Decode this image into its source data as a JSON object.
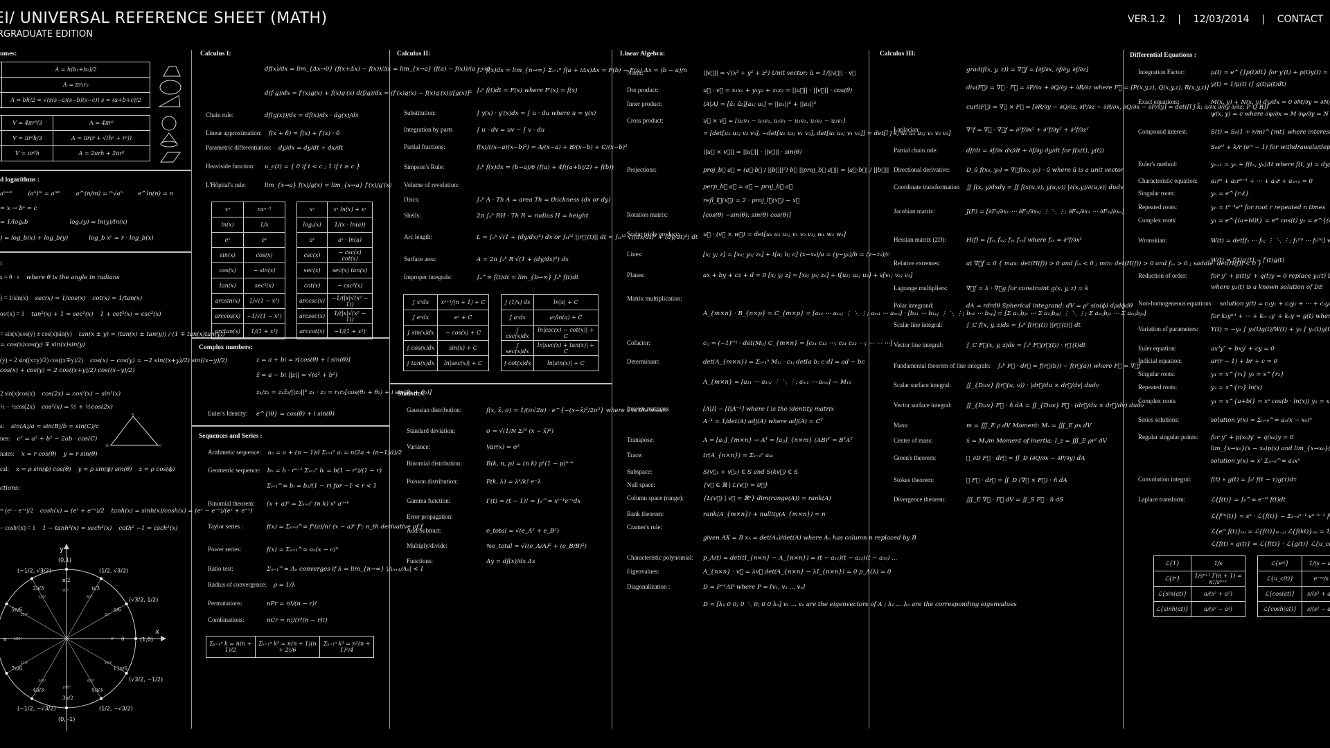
{
  "header": {
    "title": "EI/ UNIVERSAL REFERENCE SHEET (MATH)",
    "subtitle": "RGRADUATE EDITION",
    "version": "VER.1.2",
    "separator": "|",
    "date": "12/03/2014",
    "contact": "CONTACT"
  },
  "geometry": {
    "title": "umes:",
    "area_table": [
      "A = h(b₁+b₂)/2",
      "A = πr₁r₂",
      "A = bh/2 = √(s(s−a)(s−b)(s−c))   s = (a+b+c)/2"
    ],
    "volume_table": [
      [
        "V = 4πr³/3",
        "A = 4πr²"
      ],
      [
        "V = πr²h/3",
        "A = πr(r + √(h² + r²))"
      ],
      [
        "V = πr²h",
        "A = 2πrh + 2πr²"
      ]
    ]
  },
  "logs": {
    "title": "d logarithms :",
    "rows": [
      [
        "aⁿ⁺ᵐ",
        "(aⁿ)ᵐ = aⁿᵐ",
        "a^(n/m) = ᵐ√aⁿ",
        "e^ln(n) = n"
      ],
      [
        "= x  →  bˣ = c"
      ],
      [
        "= 1/logₐb",
        "logₓ(y) = ln(y)/ln(x)"
      ],
      [
        ") = log_b(x) + log_b(y)",
        "log_b xʳ = r · log_b(x)"
      ]
    ]
  },
  "trig": {
    "title": ":",
    "rows": [
      [
        "s = θ · r",
        "where θ is the angle in radians"
      ],
      [
        ") = 1/sin(x)",
        "sec(x) = 1/cos(x)",
        "cot(x) = 1/tan(x)"
      ],
      [
        "os²(x) = 1",
        "tan²(x) + 1 = sec²(x)",
        "1 + cot²(x) = csc²(x)"
      ],
      [
        "= sin(x)cos(y) ± cos(x)sin(y)",
        "tan(x ± y) = (tan(x) ± tan(y)) / (1 ∓ tan(x)tan(y))"
      ],
      [
        "= cos(x)cos(y) ∓ sin(x)sin(y)"
      ],
      [
        "(y) = 2 sin((x±y)/2) cos((x∓y)/2)",
        "cos(x) − cos(y) = −2 sin((x+y)/2) sin((x−y)/2)"
      ],
      [
        "cos(x) + cos(y) = 2 cos((x+y)/2) cos((x−y)/2)"
      ],
      [
        "2 sin(x)cos(x)",
        "cos(2x) = cos²(x) − sin²(x)"
      ],
      [
        "½ − ½cos(2x)",
        "cos²(x) = ½ + ½cos(2x)"
      ],
      [
        "s:",
        "sin(A)/a = sin(B)/b = sin(C)/c"
      ],
      [
        "nes:",
        "c² = a² + b² − 2ab · cos(C)"
      ],
      [
        "nates:",
        "x = r cos(θ)",
        "y = r sin(θ)"
      ],
      [
        "cal:",
        "x = ρ sin(ϕ) cos(θ)",
        "y = ρ sin(ϕ) sin(θ)",
        "z = ρ cos(ϕ)"
      ],
      [
        "ctions:"
      ],
      [
        "= (eˣ − e⁻ˣ)/2",
        "cosh(x) = (eˣ + e⁻ˣ)/2",
        "tanh(x) = sinh(x)/cosh(x) = (eˣ − e⁻ˣ)/(eˣ + e⁻ˣ)"
      ],
      [
        "− cosh²(x) = 1",
        "1 − tanh²(x) = sech²(x)",
        "coth² −1 = csch²(x)"
      ]
    ],
    "triangle_labels": {
      "A": "A",
      "B": "B",
      "C": "C",
      "a": "a",
      "b": "b",
      "c": "c"
    }
  },
  "unit_circle": {
    "axis_x": "x",
    "axis_y": "y",
    "points": [
      {
        "deg": "0°",
        "rad": "0",
        "coord": "(1,0)"
      },
      {
        "deg": "30°",
        "rad": "π/6",
        "coord": "(√3/2, 1/2)"
      },
      {
        "deg": "60°",
        "rad": "π/3",
        "coord": "(1/2, √3/2)"
      },
      {
        "deg": "90°",
        "rad": "π/2",
        "coord": "(0,1)"
      },
      {
        "deg": "120°",
        "rad": "2π/3",
        "coord": "(−1/2, √3/2)"
      },
      {
        "deg": "150°",
        "rad": "5π/6",
        "coord": ""
      },
      {
        "deg": "180°",
        "rad": "π",
        "coord": ""
      },
      {
        "deg": "210°",
        "rad": "7π/6",
        "coord": ""
      },
      {
        "deg": "240°",
        "rad": "4π/3",
        "coord": "(−1/2, −√3/2)"
      },
      {
        "deg": "270°",
        "rad": "3π/2",
        "coord": "(0, -1)"
      },
      {
        "deg": "300°",
        "rad": "5π/3",
        "coord": "(1/2, −√3/2)"
      },
      {
        "deg": "330°",
        "rad": "11π/6",
        "coord": "(√3/2, −1/2)"
      }
    ]
  },
  "calc1": {
    "title": "Calculus I:",
    "rows": [
      [
        "",
        "df(x)/dx = lim_{Δx→0} (f(x+Δx) − f(x))/Δx = lim_{x→a} (f(a) − f(x))/(a − x)"
      ],
      [
        "",
        "d(f·g)/dx = f′(x)g(x) + f(x)g′(x)        d(f/g)/dx = (f′(x)g(x) − f(x)g′(x))/[g(x)]²"
      ],
      [
        "Chain rule:",
        "df(g(x))/dx = df(x)/dx · dg(x)/dx"
      ],
      [
        "Linear approximation:",
        "f(x + δ) ≈ f(x) + f′(x) · δ"
      ],
      [
        "Parametric differentiation:",
        "dy/dx = dy/dt ÷ dx/dt"
      ],
      [
        "Heaviside function:",
        "u_c(t) = { 0 if t < c ; 1 if t ≥ c }"
      ],
      [
        "L'Hôpital's rule:",
        "lim_{x→a} f(x)/g(x) = lim_{x→a} f′(x)/g′(x)"
      ]
    ],
    "deriv_table_1": [
      [
        "xⁿ",
        "nxⁿ⁻¹"
      ],
      [
        "ln(x)",
        "1/x"
      ],
      [
        "eˣ",
        "eˣ"
      ],
      [
        "sin(x)",
        "cos(x)"
      ],
      [
        "cos(x)",
        "− sin(x)"
      ],
      [
        "tan(x)",
        "sec²(x)"
      ],
      [
        "arcsin(x)",
        "1/√(1 − x²)"
      ],
      [
        "arccos(x)",
        "−1/√(1 − x²)"
      ],
      [
        "arctan(x)",
        "1/(1 + x²)"
      ]
    ],
    "deriv_table_2": [
      [
        "xˣ",
        "xˣ ln(x) + xˣ"
      ],
      [
        "logₐ(x)",
        "1/(x · ln(a))"
      ],
      [
        "aˣ",
        "aˣ · ln(a)"
      ],
      [
        "csc(x)",
        "− csc(x) cot(x)"
      ],
      [
        "sec(x)",
        "sec(x) tan(x)"
      ],
      [
        "cot(x)",
        "− csc²(x)"
      ],
      [
        "arccsc(x)",
        "−1/(|x|√(x² − 1))"
      ],
      [
        "arcsec(x)",
        "1/(|x|√(x² − 1))"
      ],
      [
        "arccot(x)",
        "−1/(1 + x²)"
      ]
    ]
  },
  "complex": {
    "title": "Complex numbers:",
    "rows": [
      [
        "",
        "z = a + bi = r[cos(θ) + i sin(θ)]"
      ],
      [
        "",
        "z̄ = a − bi        ||z|| = √(a² + b²)"
      ],
      [
        "",
        "z₁/z₂ = z₁z̄₂/||z₂||²        z₁ · z₂ = r₁r₂[cos(θ₁ + θ₂) + i sin(θ₁ + θ₂)]"
      ],
      [
        "Euler's Identity:",
        "e^{iθ} = cos(θ) + i sin(θ)"
      ]
    ]
  },
  "series": {
    "title": "Sequences and Series :",
    "rows": [
      [
        "Arithmetic sequence:",
        "aₙ = a + (n − 1)d     Σᵢ₌₁ⁿ aᵢ = n(2a + (n−1)d)/2"
      ],
      [
        "Geometric sequence:",
        "bₙ = b · rⁿ⁻¹         Σᵢ₌₁ⁿ bᵢ = b(1 − rⁿ)/(1 − r)"
      ],
      [
        "",
        "Σᵢ₌₁^∞ bᵢ = b₁/(1 − r)   for −1 < r < 1"
      ],
      [
        "Binomial theorem:",
        "(x + a)ⁿ = Σₖ₌₀ⁿ (n k) xᵏ aⁿ⁻ᵏ"
      ],
      [
        "Taylor series :",
        "f(x) = Σₙ₌₀^∞ fⁿ(a)/n! (x − a)ⁿ     fⁿ: n_th derivative of f"
      ],
      [
        "Power series:",
        "f(x) = Σₙ₌₁^∞ aₙ(x − c)ⁿ"
      ],
      [
        "Ratio test:",
        "Σₙ₌₁^∞ Aₙ  converges if λ = lim_{n→∞} |Aₙ₊₁/Aₙ| < 1"
      ],
      [
        "    Radius of convergence:",
        "ρ = 1/λ"
      ],
      [
        "Permutations:",
        "nPr = n!/(n − r)!"
      ],
      [
        "Combinations:",
        "nCr = n!/(r!(n − r)!)"
      ]
    ],
    "sums": [
      "Σₖ₌₁ⁿ k = n(n + 1)/2",
      "Σₖ₌₁ⁿ k² = n(n + 1)(n + 2)/6",
      "Σₖ₌₁ⁿ k³ = n²(n + 1)²/4"
    ]
  },
  "calc2": {
    "title": "Calculus II:",
    "rows": [
      [
        "",
        "∫ₐᵇ f(x)dx = lim_{n→∞} Σᵢ₌₁ⁿ f(a + iΔx)Δx = F(b) − F(a)        Δx = (b − a)/n"
      ],
      [
        "",
        "∫ₐˣ f(t)dt = F(x)        where F′(x) = f(x)"
      ],
      [
        "Substitution:",
        "∫ y(x) · y′(x)dx = ∫ u · du       where u = y(x)"
      ],
      [
        "Integration by parts",
        "∫ u · dv = uv − ∫ v · du"
      ],
      [
        "Partial fractions:",
        "f(x)/((x−a)(x−b)²) = A/(x−a) + B/(x−b) + C/(x−b)²"
      ],
      [
        "Simpson's Rule:",
        "∫ₐᵇ f(x)dx ≈ (b−a)/6 (f(a) + 4f((a+b)/2) + f(b))"
      ],
      [
        "Volume of revolution:",
        ""
      ],
      [
        "      Discs:",
        "∫ₐᵇ A · Th      A = area      Th = thickness (dx or dy)"
      ],
      [
        "      Shells:",
        "2π ∫ₐᵇ RH · Th      R = radius      H = height"
      ],
      [
        "Arc length:",
        "L = ∫ₐᵇ √(1 + (dy/dx)²) dx   or   ∫ₜ₁ᵗ² ||r⃗′(t)|| dt = ∫ₜ₁ᵗ² √((dx/dt)² + (dy/dt)²) dt"
      ],
      [
        "Surface area:",
        "A = 2π ∫ₐᵇ R √(1 + (dy/dx)²) dx"
      ],
      [
        "Improper integrals:",
        "∫ₐ^∞ f(t)dt = lim_{b→∞} ∫ₐᵇ f(t)dt"
      ]
    ],
    "int_table_1": [
      [
        "∫ xⁿdx",
        "xⁿ⁺¹/(n + 1) + C"
      ],
      [
        "∫ eˣdx",
        "eˣ + C"
      ],
      [
        "∫ sin(x)dx",
        "− cos(x) + C"
      ],
      [
        "∫ cos(x)dx",
        "sin(x) + C"
      ],
      [
        "∫ tan(x)dx",
        "ln|sec(x)| + C"
      ]
    ],
    "int_table_2": [
      [
        "∫ (1/x) dx",
        "ln|x| + C"
      ],
      [
        "∫ aˣdx",
        "aˣ/ln(a) + C"
      ],
      [
        "∫ csc(x)dx",
        "ln|csc(x) − cot(x)| + C"
      ],
      [
        "∫ sec(x)dx",
        "ln|sec(x) + tan(x)| + C"
      ],
      [
        "∫ cot(x)dx",
        "ln|sin(x)| + C"
      ]
    ]
  },
  "stats": {
    "title": "Statistics:",
    "rows": [
      [
        "Gaussian distribution:",
        "f(x, x̄, σ) = 1/(σ√2π) · e^{−(x−x̄)²/2σ²}   where x̄ is the mean"
      ],
      [
        "Standard deviation:",
        "σ = √(1/N Σᵢᴺ (x − x̄)²)"
      ],
      [
        "Variance:",
        "Var(x) = σ²"
      ],
      [
        "Binomial distribution:",
        "B(k, n, p) = (n k) pᵏ(1 − p)ⁿ⁻ᵏ"
      ],
      [
        "Poisson distribution:",
        "P(k, λ) = λᵏ/k! e⁻λ"
      ],
      [
        "Gamma function:",
        "Γ(t) = (t − 1)! = ∫₀^∞ xᵗ⁻¹e⁻ˣdx"
      ],
      [
        "Error propagation:",
        ""
      ],
      [
        "      Add/Subtract:",
        "e_total = √(e_A² + e_B²)"
      ],
      [
        "      Multiply/divide:",
        "%e_total = √((e_A/A)² + (e_B/B)²)"
      ],
      [
        "      Functions:",
        "Δy = df(x)/dx Δx"
      ]
    ]
  },
  "linalg": {
    "title": "Linear Algebra:",
    "rows": [
      [
        "Norm:",
        "||v⃗|| = √(x² + y² + z²)              Unit vector:    û = 1/||v⃗|| · v⃗"
      ],
      [
        "Dot product:",
        "u⃗ · v⃗ = x₁x₂ + y₁y₂ + z₁z₂ = ||u⃗|| · ||v⃗|| · cos(θ)"
      ],
      [
        "        Inner product:",
        "⟨A|A⟩ = [ā₁ ā₂][a₁; a₂] = ||a₁||² + ||a₂||²"
      ],
      [
        "Cross product:",
        "u⃗ × v⃗ = [u₂v₃ − u₃v₂, u₃v₁ − u₁v₃, u₁v₂ − u₂v₁]"
      ],
      [
        "",
        "= [det[u₂ u₃; v₂ v₃], −det[u₁ u₃; v₁ v₃], det[u₁ u₂; v₁ v₂]] = det[î ĵ k̂; u₁ u₂ u₃; v₁ v₂ v₃]"
      ],
      [
        "",
        "||u⃗ × v⃗|| = ||u⃗|| · ||v⃗|| · sin(θ)"
      ],
      [
        "Projections:",
        "proj_b⃗ a⃗ = (a⃗·b⃗ / ||b⃗||²) b⃗          ||proj_b⃗ a⃗|| = |a⃗·b⃗| / ||b⃗||"
      ],
      [
        "",
        "perp_b⃗ a⃗ = a⃗ − proj_b⃗ a⃗"
      ],
      [
        "",
        "refl_l⃗(x⃗) = 2 · proj_l⃗(x⃗) − x⃗"
      ],
      [
        "Rotation matrix:",
        "[cos(θ) −sin(θ); sin(θ) cos(θ)]"
      ],
      [
        "Scalar triple product:",
        "u⃗ · (v⃗ × w⃗) = det[u₁ u₂ u₃; v₁ v₂ v₃; w₁ w₂ w₃]"
      ],
      [
        "Lines:",
        "[x; y; z] = [x₀; y₀; z₀] + t[a; b; c]      (x−x₀)/a = (y−y₀)/b = (z−z₀)/c"
      ],
      [
        "Planes:",
        "ax + by + cz + d = 0      [x; y; z] = [x₀; y₀; z₀] + t[u₁; u₂; u₃] + s[v₁; v₂; v₃]"
      ],
      [
        "Matrix multiplication:",
        ""
      ],
      [
        "",
        "A_{m×n} · B_{n×p} = C_{m×p} = [a₁₁ ⋯ a₁ₙ; ⋮ ⋱ ⋮; aₘ₁ ⋯ aₘₙ] · [b₁₁ ⋯ b₁ₚ; ⋮ ⋱ ⋮; bₙ₁ ⋯ bₙₚ] = [Σ a₁ⱼbⱼ₁ ⋯ Σ a₁ⱼbⱼₚ; ⋮ ⋱ ⋮; Σ aₘⱼbⱼ₁ ⋯ Σ aₘⱼbⱼₚ]"
      ],
      [
        "Cofactor:",
        "cᵢⱼ = (−1)ⁱ⁺ʲ · det(Mᵢⱼ)      C_{m×n} = [c₁₁ c₁₂ ⋯; c₂₁ c₂₂ ⋯; ⋯ ⋯ ⋯]"
      ],
      [
        "Determinant:",
        "det(A_{m×n}) = Σⱼ₌₁ⁿ M₁ⱼ · c₁ⱼ        det[a b; c d] = ad − bc"
      ],
      [
        "",
        "A_{m×n} = [a₁₁ ⋯ a₁ₙ; ⋮ ⋱ ⋮; aₘ₁ ⋯ aₘₙ]   — M₁₁"
      ],
      [
        "Inverse matrices:",
        "[A|I] ~ [I|A⁻¹]    where I is the identity matrix"
      ],
      [
        "",
        "A⁻¹ = 1/det(A) adj(A)       where adj(A) = Cᵀ"
      ],
      [
        "Transpose:",
        "A = [aᵢⱼ]_{m×n} → Aᵀ = [aⱼᵢ]_{n×m}           (AB)ᵀ = BᵀAᵀ"
      ],
      [
        "Trace:",
        "tr(A_{n×n}) = Σₖ₌₁ⁿ aₖₖ"
      ],
      [
        "Subspace:",
        "S(v⃗₁ + v⃗₂) ∈ S    and    S(kv⃗) ∈ S"
      ],
      [
        "        Null space:",
        "{v⃗ ∈ ℝ | L(v⃗) = 0⃗}"
      ],
      [
        "        Column space (range):",
        "{L(v⃗) | v⃗ = ℝⁿ}           dim(range(A)) = rank(A)"
      ],
      [
        "Rank theorem:",
        "rank(A_{m×n}) + nullity(A_{m×n}) = n"
      ],
      [
        "Cramer's rule:",
        ""
      ],
      [
        "",
        "given AX = B        xₙ = det(Aₙ)/det(A)       where Aₙ has column n replaced by B"
      ],
      [
        "Characteristic polynomial:",
        "p_A(t) = det(tI_{n×n} − A_{n×n}) = (t − a₁₁)(t − a₂₂)(t − a₃₃) ..."
      ],
      [
        "Eigenvalues:",
        "A_{n×n} · v⃗ = λv⃗        det(A_{n×n} − λI_{n×n}) = 0         p_A(λ) = 0"
      ],
      [
        "Diagonalization :",
        "D = P⁻¹AP     where P = [v₁, v₂ ... vₙ]"
      ],
      [
        "",
        "D = [λ₁ 0 0; 0 ⋱ 0; 0 0 λₙ]     v₁ ... vₙ are the eigenvectors of A ; λ₁ ... λₙ are the corresponding eigenvalues"
      ]
    ]
  },
  "calc3": {
    "title": "Calculus III:",
    "rows": [
      [
        "",
        "grad(f(x, y, z)) = ∇⃗f = [∂f/∂x, ∂f/∂y, ∂f/∂z]"
      ],
      [
        "",
        "div(F⃗) = ∇⃗ · F⃗ = ∂P/∂x + ∂Q/∂y + ∂R/∂z        where F⃗ = [P(x,y,z), Q(x,y,z), R(x,y,z)]"
      ],
      [
        "",
        "curl(F⃗) = ∇⃗ × F⃗ = [∂R/∂y − ∂Q/∂z, ∂P/∂z − ∂R/∂x, ∂Q/∂x − ∂P/∂y] = det([î ĵ k̂; ∂/∂x ∂/∂y ∂/∂z; P Q R])"
      ],
      [
        "Laplacian:",
        "∇²f = ∇⃗ · ∇⃗f = ∂²f/∂x² + ∂²f/∂y² + ∂²f/∂z²"
      ],
      [
        "Partial chain rule:",
        "df/dt = ∂f/∂x dx/dt + ∂f/∂y dy/dt        for f(x(t), y(t))"
      ],
      [
        "Directional derivative:",
        "D_û f(x₀, y₀) = ∇⃗f(x₀, y₀) · û     where û is a unit vector"
      ],
      [
        "Coordinate transformation",
        "∬ f(x, y)dxdy = ∬ f(x(u,v), y(u,v)) |∂(x,y)/∂(u,v)| dudv"
      ],
      [
        "Jacobian matrix:",
        "J(F) = [∂F₁/∂x₁ ⋯ ∂F₁/∂xₙ; ⋮ ⋱ ⋮; ∂Fₘ/∂x₁ ⋯ ∂Fₘ/∂xₙ]"
      ],
      [
        "Hessian matrix (2D):",
        "H(f) = [fₓₓ fₓᵧ; fᵧₓ fᵧᵧ]   where fₓₓ = ∂²f/∂x²"
      ],
      [
        "Relative extremes:",
        "at ∇⃗f = 0   { max: det(H(f)) > 0 and fₓₓ < 0 ; min: det(H(f)) > 0 and fₓₓ > 0 ; saddle: det(H(f)) < 0 }"
      ],
      [
        "Lagrange multipliers:",
        "∇⃗f = λ · ∇⃗g     for constraint g(x, y, z) = k"
      ],
      [
        "Polar integrand:",
        "dA = rdrdθ              Spherical integrand:   dV = ρ² sin(ϕ) dρdϕdθ"
      ],
      [
        "Scalar line integral:",
        "∫_C f(x, y, z)ds = ∫ₐᵇ f(r⃗(t)) ||r⃗′(t)|| dt"
      ],
      [
        "Vector line integral:",
        "∫_C F⃗(x, y, z)ds = ∫ₐᵇ F⃗(r⃗(t)) · r⃗′(t)dt"
      ],
      [
        "Fundamental theorem of line integrals:",
        "∫ₐᵇ F⃗ · dr⃗ = f(r⃗(b)) − f(r⃗(a))    where F⃗ = ∇⃗f"
      ],
      [
        "Scalar surface integral:",
        "∬_{Duv} f(r⃗(u, v)) · |dr⃗/du × dr⃗/dv| dudv"
      ],
      [
        "Vector surface integral:",
        "∬_{Duv} F⃗ · n̂ dA = ∬_{Duv} F⃗ · (dr⃗/du × dr⃗/dv) dudv"
      ],
      [
        "Mass:",
        "m = ∭_E ρ dV                 Moment:      Mₓ = ∭_E ρx dV"
      ],
      [
        "Center of mass:",
        "x̄ = Mₓ/m                   Moment of inertia:     I_z = ∭_E ρr² dV"
      ],
      [
        "Green's theorem:",
        "∮_∂D F⃗ · dr⃗ = ∬_D (∂Q/∂x − ∂P/∂y) dA"
      ],
      [
        "Stokes theorem:",
        "∮ F⃗ · dr⃗ = ∬_D (∇⃗ × F⃗) · n̂ dA"
      ],
      [
        "Divergence theorem:",
        "∭_E ∇⃗ · F⃗ dV = ∬_S F⃗ · n̂ dS"
      ]
    ]
  },
  "diffeq": {
    "title": "Differential Equations :",
    "rows": [
      [
        "Integration Factor:",
        "μ(t) = e^{∫p(t)dt}     for  y′(t) + p(t)y(t) = g(t)"
      ],
      [
        "",
        "y(t) = 1/μ(t) (∫ g(t)μ(t)dt)"
      ],
      [
        "Exact equations:",
        "M(x, y) + N(x, y) dy/dx = 0       ∂M/∂y = ∂N/∂x"
      ],
      [
        "",
        "ψ(x, y) = c     where  ∂ψ/∂x = M   ∂ψ/∂y = N"
      ],
      [
        "Compound interest:",
        "S(t) = S₀(1 + r/m)^{mt}   where interest is compounded"
      ],
      [
        "",
        "S₀eʳᵗ + k/r (eʳᵗ − 1)    for withdrawals/deposits at"
      ],
      [
        "Euler's method:",
        "yₙ₊₁ = yₙ + f(tₙ, yₙ)Δt    where  f(t, y) = dy/dt"
      ],
      [
        "Characteristic equation:",
        "a₁rⁿ + a₂rⁿ⁻¹ + ⋯ + aₙr + aₙ₊₁ = 0"
      ],
      [
        "      Singular roots:",
        "yₙ = e^{rₙt}"
      ],
      [
        "      Repeated roots:",
        "yₙ = tⁿ⁻¹eʳᵗ      for root r repeated n times"
      ],
      [
        "      Complex roots:",
        "y₁ = e^{(a+bi)t} = eᵃᵗ cos(t)       y₂ = e^{(a−bi)t} ="
      ],
      [
        "Wronskian:",
        "W(t) = det[f₁ ⋯ fₙ; ⋮ ⋱ ⋮; f₁⁽ⁿ⁾ ⋯ fₙ⁽ⁿ⁾]     where f⁽ⁿ⁾ is the nth deriv"
      ],
      [
        "",
        "W(t) = f(t)g′(t) − f′(t)g(t)"
      ],
      [
        "Reduction of order:",
        "for y″ + p(t)y′ + q(t)y = 0      replace y₂(t) by v(t"
      ],
      [
        "",
        "where y₂(t) is a known solution of DE"
      ],
      [
        "Non-homogeneous equations:",
        "solution  y(t) = c₁y₁ + c₂y₂ + ⋯ + cₙyₙ"
      ],
      [
        "",
        "for k₁y⁽ⁿ⁾ + ⋯ + kₙ₋₁y′ + kₙy = g(t)  where Y(t) is related"
      ],
      [
        "      Variation of parameters:",
        "Y(t) = −y₁ ∫ y₂(t)g(t)/W(t) + y₂ ∫ y₁(t)g(t)/W(t)"
      ],
      [
        "Euler equation:",
        "ax²y″ + bxy′ + cy = 0"
      ],
      [
        "      Indicial equation:",
        "ar(r − 1) + br + c = 0"
      ],
      [
        "      Singular roots:",
        "y₁ = x^{r₁}        y₂ = x^{r₂}"
      ],
      [
        "      Repeated roots:",
        "y₂ = x^{r₂} ln(x)"
      ],
      [
        "      Complex roots:",
        "y₁ = x^{a+bi} = xᵃ cos(b · ln(x))      y₂ = x^{a−bi} = x"
      ],
      [
        "Series solutions:",
        "solution  y(x) = Σₙ₌₀^∞ aₙ(x − x₀)ⁿ"
      ],
      [
        "      Regular singular points:",
        "for y″ + p(x₀)y′ + q(x₀)y = 0"
      ],
      [
        "",
        "lim_{x→x₀}(x − x₀)p(x)  and  lim_{x→x₀}(x − x₀)²q(x"
      ],
      [
        "",
        "solution  y(x) = xʳ Σₙ₌₀^∞ aₙxⁿ"
      ],
      [
        "Convolution integral:",
        "f(t) ∗ g(t) = ∫₀ᵗ f(t − τ)g(τ)dτ"
      ],
      [
        "Laplace transform:",
        "ℒ{f(t)} = ∫₀^∞ e⁻ˢᵗ f(t)dt"
      ],
      [
        "",
        "ℒ{f⁽ⁿ⁾(t)} = sⁿ · ℒ{f(t)} − Σₖ₌₀ⁿ⁻¹ sⁿ⁻ᵏ⁻¹ f⁽ᵏ⁾(0)"
      ],
      [
        "",
        "ℒ{eᶜᵗ f(t)}₍ₛ₎ = ℒ{f(t)}₍ₛ₋꜀₎              ℒ{f(kt)}₍ₛ₎ = 1/k ℒ{f(t)}₍ₛ/ₖ₎"
      ],
      [
        "",
        "ℒ{f(t) ∗ g(t)} = ℒ{f(t)} · ℒ{g(t)}         ℒ{u_c(t)f(t − c)} = e⁻ᶜˢℒ{"
      ]
    ],
    "laplace_table_1": [
      [
        "ℒ{1}",
        "1/s"
      ],
      [
        "ℒ{tⁿ}",
        "1/sⁿ⁺¹ Γ(n + 1) = n!/sⁿ⁺¹"
      ],
      [
        "ℒ{sin(at)}",
        "a/(s² + a²)"
      ],
      [
        "ℒ{sinh(at)}",
        "a/(s² − a²)"
      ]
    ],
    "laplace_table_2": [
      [
        "ℒ{eᵃᵗ}",
        "1/(s − a)"
      ],
      [
        "ℒ{u_c(t)}",
        "e⁻ᶜˢ/s"
      ],
      [
        "ℒ{cos(at)}",
        "s/(s² + a²)"
      ],
      [
        "ℒ{cosh(at)}",
        "s/(s² − a²)"
      ]
    ]
  }
}
